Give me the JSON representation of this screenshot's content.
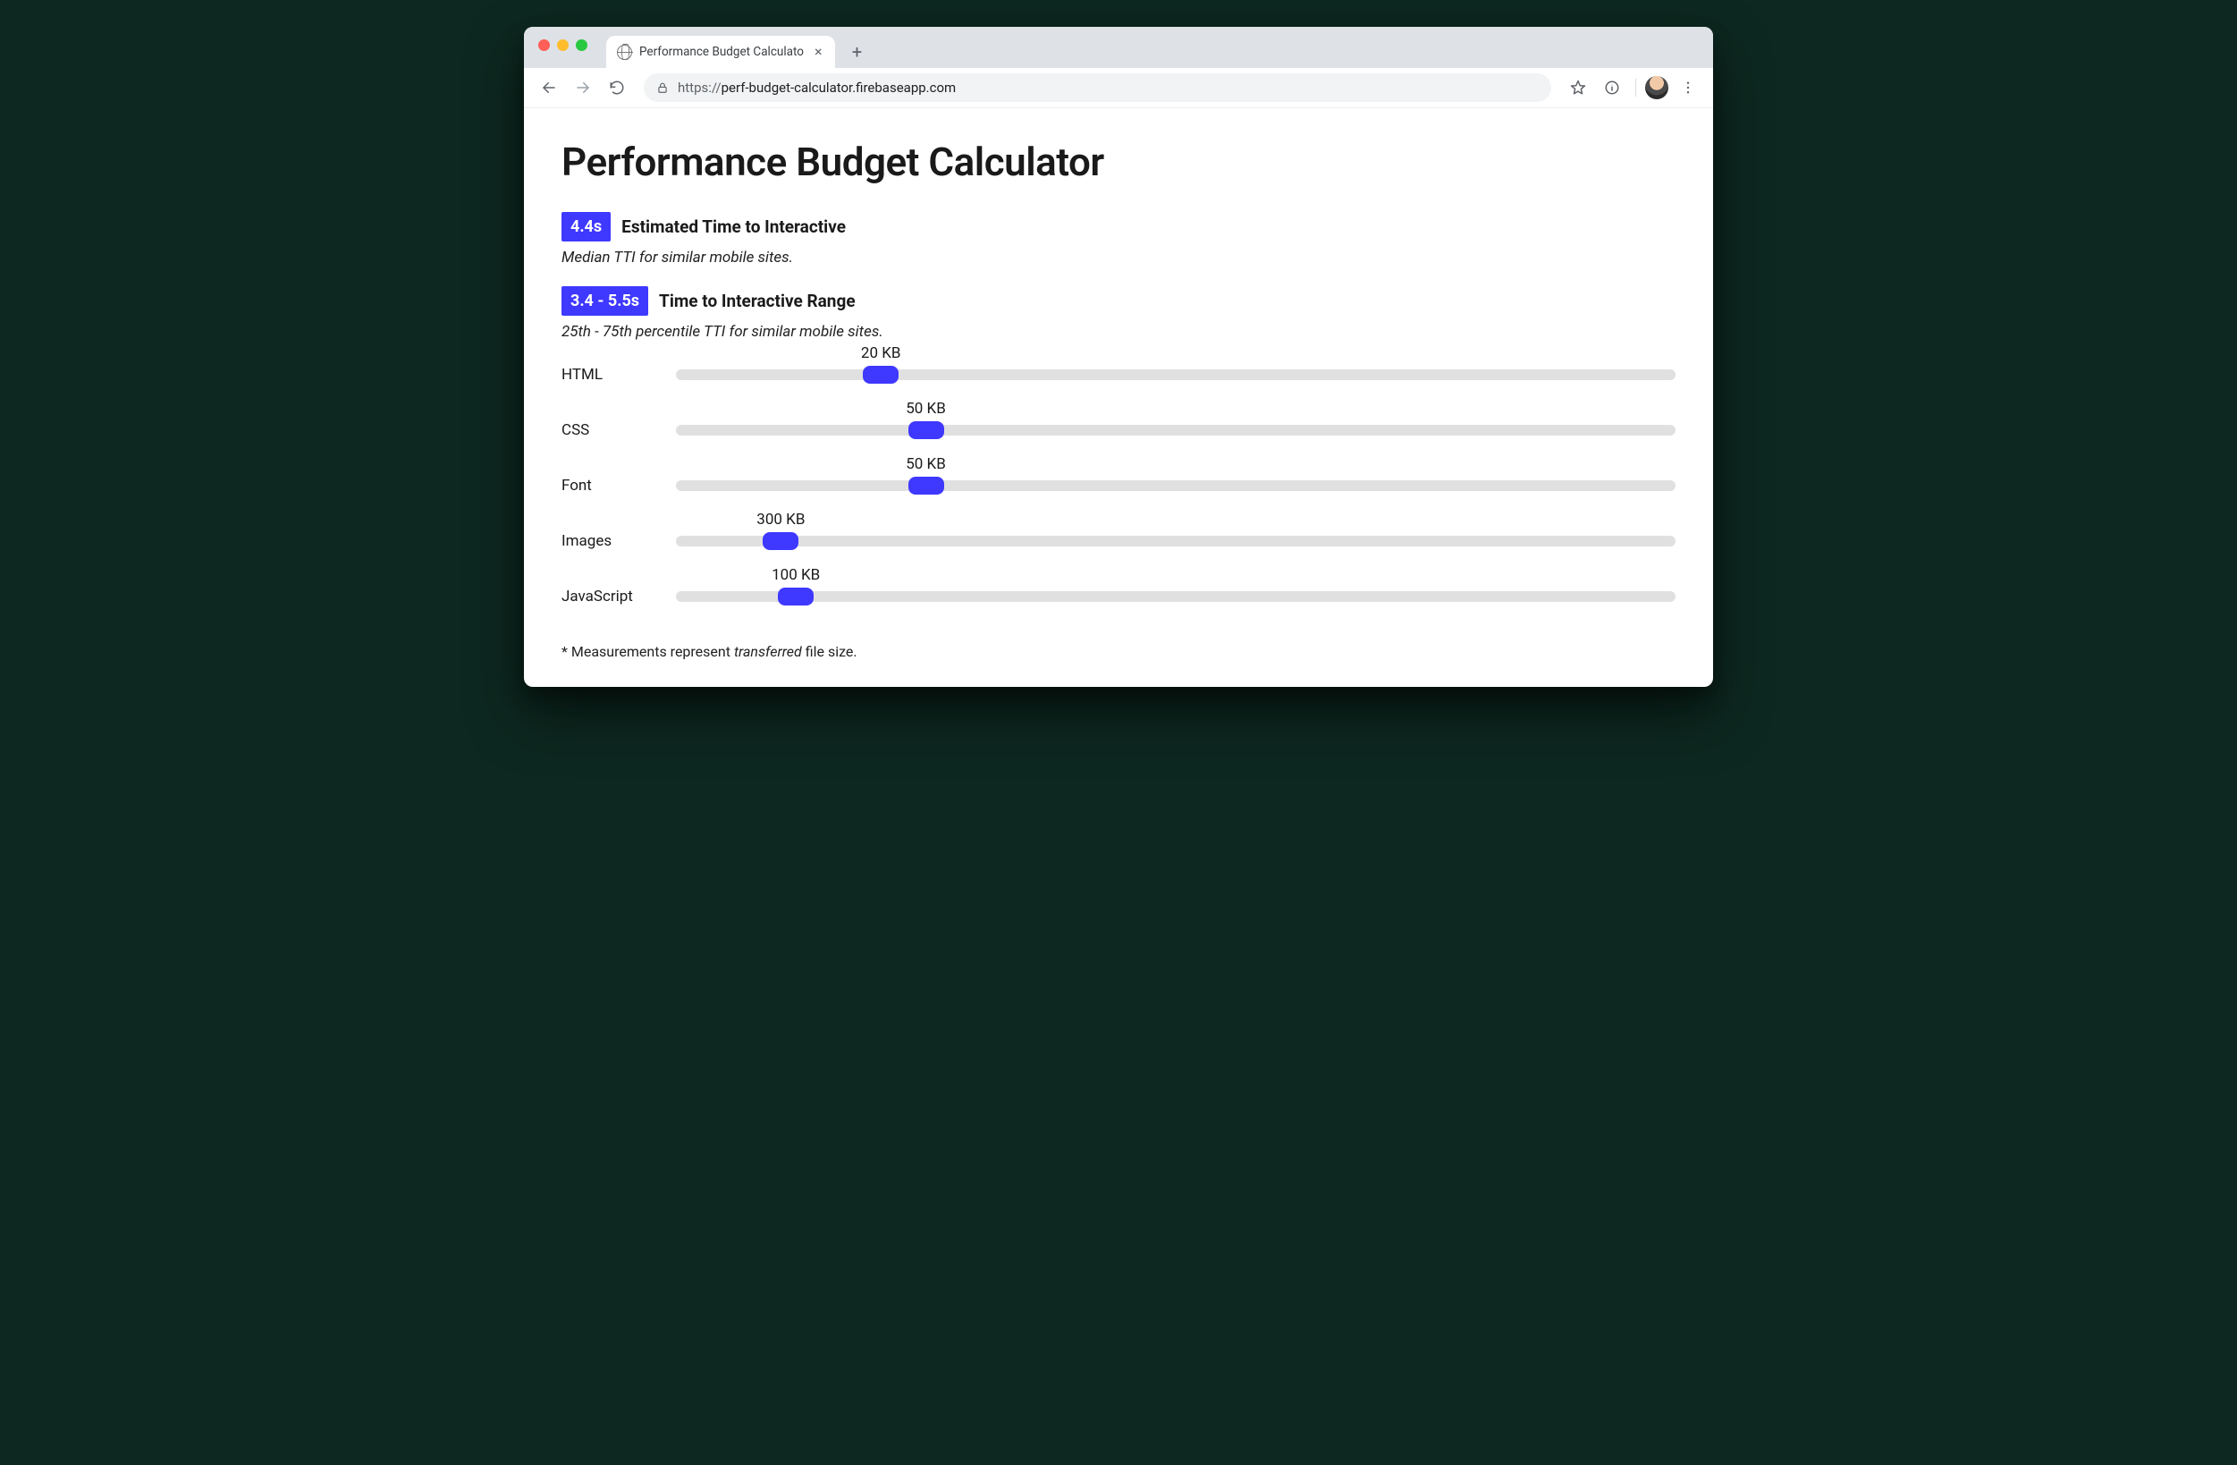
{
  "browser": {
    "tab_title": "Performance Budget Calculato",
    "url_protocol": "https://",
    "url_host_path": "perf-budget-calculator.firebaseapp.com",
    "new_tab_tooltip": "New tab"
  },
  "page": {
    "title": "Performance Budget Calculator",
    "tti": {
      "value": "4.4s",
      "label": "Estimated Time to Interactive",
      "sub": "Median TTI for similar mobile sites."
    },
    "tti_range": {
      "value": "3.4 - 5.5s",
      "label": "Time to Interactive Range",
      "sub": "25th - 75th percentile TTI for similar mobile sites."
    },
    "sliders": [
      {
        "label": "HTML",
        "value_text": "20 KB",
        "pos_pct": 20.5
      },
      {
        "label": "CSS",
        "value_text": "50 KB",
        "pos_pct": 25
      },
      {
        "label": "Font",
        "value_text": "50 KB",
        "pos_pct": 25
      },
      {
        "label": "Images",
        "value_text": "300 KB",
        "pos_pct": 10.5
      },
      {
        "label": "JavaScript",
        "value_text": "100 KB",
        "pos_pct": 12
      }
    ],
    "footnote_prefix": "* Measurements represent ",
    "footnote_em": "transferred",
    "footnote_suffix": " file size."
  }
}
